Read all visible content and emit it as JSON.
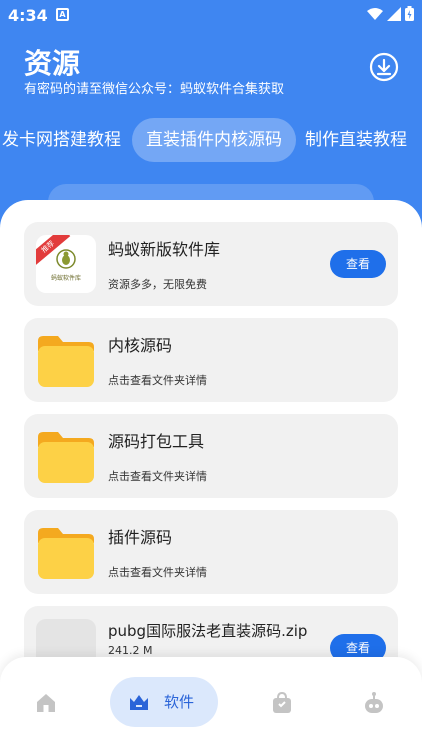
{
  "status_bar": {
    "time": "4:34",
    "app_glyph": "A"
  },
  "header": {
    "title": "资源",
    "subtitle": "有密码的请至微信公众号：蚂蚁软件合集获取",
    "download_icon": "download-icon"
  },
  "tabs": [
    {
      "label": "发卡网搭建教程",
      "active": false
    },
    {
      "label": "直装插件内核源码",
      "active": true
    },
    {
      "label": "制作直装教程",
      "active": false
    }
  ],
  "items": [
    {
      "title": "蚂蚁新版软件库",
      "desc": "资源多多，无限免费",
      "button": "查看",
      "thumb": "logo",
      "badge": "推荐",
      "logo_text": "蚂蚁软件库"
    },
    {
      "title": "内核源码",
      "desc": "点击查看文件夹详情",
      "thumb": "folder"
    },
    {
      "title": "源码打包工具",
      "desc": "点击查看文件夹详情",
      "thumb": "folder"
    },
    {
      "title": "插件源码",
      "desc": "点击查看文件夹详情",
      "thumb": "folder"
    },
    {
      "title": "pubg国际服法老直装源码.zip",
      "desc": "241.2 M",
      "button": "查看",
      "thumb": "blank"
    }
  ],
  "bottom_nav": [
    {
      "label": "",
      "icon": "home-icon"
    },
    {
      "label": "软件",
      "icon": "apps-icon",
      "active": true
    },
    {
      "label": "",
      "icon": "bag-icon"
    },
    {
      "label": "",
      "icon": "robot-icon"
    }
  ],
  "colors": {
    "primary": "#3f86f1",
    "button": "#1f6fea",
    "card": "#f1f1f1",
    "folder": "#fdd146"
  }
}
